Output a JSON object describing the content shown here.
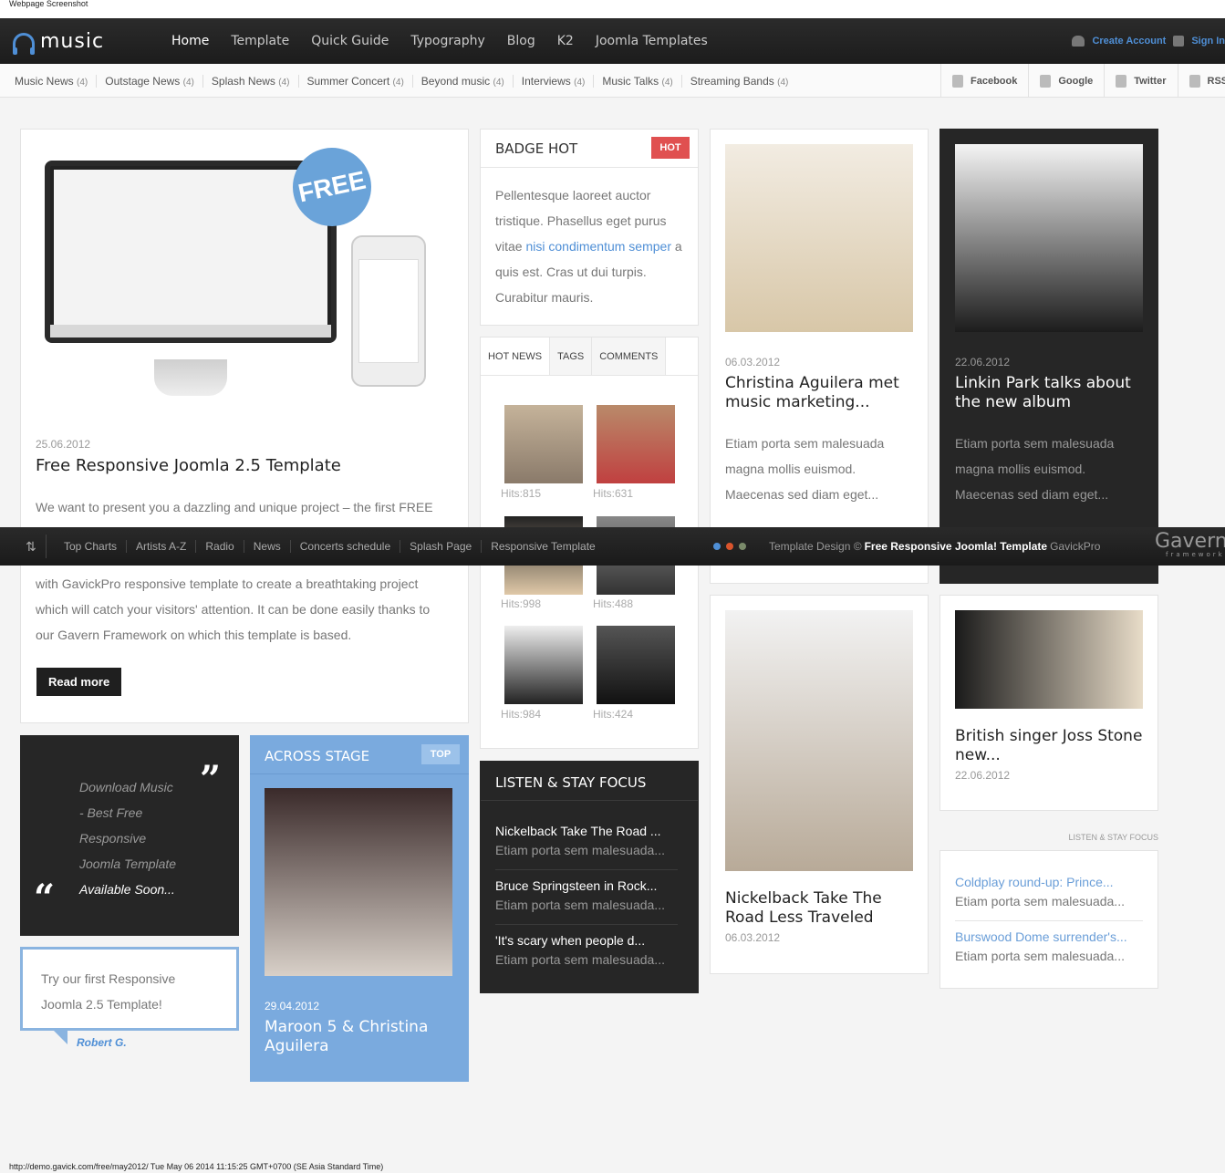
{
  "caption": "Webpage Screenshot",
  "footer_caption": "http://demo.gavick.com/free/may2012/ Tue May 06 2014 11:15:25 GMT+0700 (SE Asia Standard Time)",
  "logo": {
    "text": "music"
  },
  "nav": {
    "items": [
      "Home",
      "Template",
      "Quick Guide",
      "Typography",
      "Blog",
      "K2",
      "Joomla Templates"
    ],
    "active": "Home",
    "create_account": "Create Account",
    "sign_in": "Sign In"
  },
  "categories": [
    {
      "label": "Music News",
      "count": "(4)"
    },
    {
      "label": "Outstage News",
      "count": "(4)"
    },
    {
      "label": "Splash News",
      "count": "(4)"
    },
    {
      "label": "Summer Concert",
      "count": "(4)"
    },
    {
      "label": "Beyond music",
      "count": "(4)"
    },
    {
      "label": "Interviews",
      "count": "(4)"
    },
    {
      "label": "Music Talks",
      "count": "(4)"
    },
    {
      "label": "Streaming Bands",
      "count": "(4)"
    }
  ],
  "social": [
    "Facebook",
    "Google",
    "Twitter",
    "RSS"
  ],
  "main_article": {
    "badge": "FREE",
    "date": "25.06.2012",
    "title": "Free Responsive Joomla 2.5 Template",
    "p1": "We want to present you a dazzling and unique project – the first FREE",
    "p2": "with GavickPro responsive template to create a breathtaking project",
    "p3": "which will catch your visitors' attention. It can be done easily thanks to",
    "p4": "our Gavern Framework on which this template is based.",
    "read_more": "Read more"
  },
  "badge_hot": {
    "title": "BADGE HOT",
    "badge": "HOT",
    "l1": "Pellentesque laoreet auctor",
    "l2": "tristique. Phasellus eget purus",
    "l3a": "vitae ",
    "l3link": "nisi condimentum semper",
    "l3b": " a",
    "l4": "quis est. Cras ut dui turpis.",
    "l5": "Curabitur mauris."
  },
  "tabs": {
    "labels": [
      "HOT NEWS",
      "TAGS",
      "COMMENTS"
    ],
    "hits": [
      "Hits:815",
      "Hits:631",
      "Hits:998",
      "Hits:488",
      "Hits:984",
      "Hits:424"
    ]
  },
  "col3_top": {
    "date": "06.03.2012",
    "title1": "Christina Aguilera met",
    "title2": "music marketing...",
    "l1": "Etiam porta sem malesuada",
    "l2": "magna mollis euismod.",
    "l3": "Maecenas sed diam eget..."
  },
  "col4_top": {
    "date": "22.06.2012",
    "title1": "Linkin Park talks about",
    "title2": "the new album",
    "l1": "Etiam porta sem malesuada",
    "l2": "magna mollis euismod.",
    "l3": "Maecenas sed diam eget..."
  },
  "footer_bar": {
    "menu": [
      "Top Charts",
      "Artists A-Z",
      "Radio",
      "News",
      "Concerts schedule",
      "Splash Page",
      "Responsive Template"
    ],
    "copy_pre": "Template Design ©",
    "copy_bold": "Free Responsive Joomla! Template",
    "copy_post": "GavickPro",
    "brand": "Gavern",
    "brand_sub": "framework",
    "dot_colors": [
      "#4f8fd6",
      "#d9542c",
      "#7a8a6a"
    ]
  },
  "quote": {
    "l1": "Download Music",
    "l2": "- Best Free",
    "l3": "Responsive",
    "l4": "Joomla Template",
    "l5": "Available Soon..."
  },
  "testimonial": {
    "l1": "Try our first Responsive",
    "l2": "Joomla 2.5 Template!",
    "author": "Robert G."
  },
  "across": {
    "title": "ACROSS STAGE",
    "badge": "TOP",
    "date": "29.04.2012",
    "t1": "Maroon 5 & Christina",
    "t2": "Aguilera"
  },
  "listen": {
    "title": "LISTEN & STAY FOCUS",
    "items": [
      {
        "t": "Nickelback Take The Road ...",
        "d": "Etiam porta sem malesuada..."
      },
      {
        "t": "Bruce Springsteen in Rock...",
        "d": "Etiam porta sem malesuada..."
      },
      {
        "t": "'It's scary when people d...",
        "d": "Etiam porta sem malesuada..."
      }
    ]
  },
  "col3_bottom": {
    "t1": "Nickelback Take The",
    "t2": "Road Less Traveled",
    "date": "06.03.2012"
  },
  "col4_bottom": {
    "t1": "British singer Joss Stone",
    "t2": "new...",
    "date": "22.06.2012"
  },
  "listen_small": {
    "heading": "LISTEN & STAY FOCUS",
    "items": [
      {
        "t": "Coldplay round-up: Prince...",
        "d": "Etiam porta sem malesuada..."
      },
      {
        "t": "Burswood Dome surrender's...",
        "d": "Etiam porta sem malesuada..."
      }
    ]
  },
  "colors": {
    "accent": "#4f8fd6",
    "hot": "#e05050",
    "dark": "#262626"
  }
}
